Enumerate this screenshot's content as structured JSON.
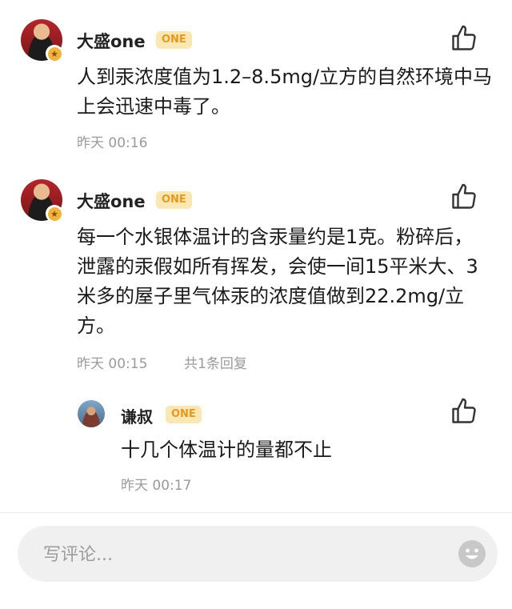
{
  "comments": [
    {
      "user": "大盛one",
      "badge": "ONE",
      "text": "人到汞浓度值为1.2–8.5mg/立方的自然环境中马上会迅速中毒了。",
      "time": "昨天 00:16",
      "replies": ""
    },
    {
      "user": "大盛one",
      "badge": "ONE",
      "text": "每一个水银体温计的含汞量约是1克。粉碎后，泄露的汞假如所有挥发，会使一间15平米大、3米多的屋子里气体汞的浓度值做到22.2mg/立方。",
      "time": "昨天 00:15",
      "replies": "共1条回复"
    }
  ],
  "reply": {
    "user": "谦叔",
    "badge": "ONE",
    "text": "十几个体温计的量都不止",
    "time": "昨天 00:17"
  },
  "input": {
    "placeholder": "写评论..."
  },
  "icons": {
    "like": "thumbs-up-icon",
    "emoji": "smiley-icon",
    "badge": "star-icon"
  },
  "colors": {
    "badge_bg": "#fbe7b4",
    "badge_text": "#e69a1b",
    "meta": "#9a9a9a"
  }
}
